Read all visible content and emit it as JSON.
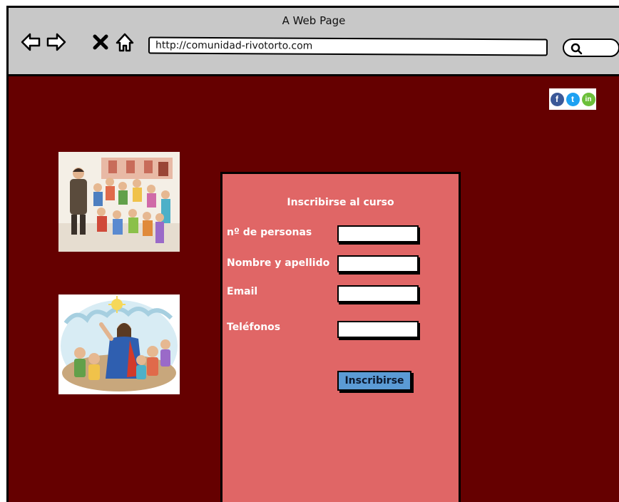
{
  "window": {
    "title": "A Web Page",
    "url": "http://comunidad-rivotorto.com"
  },
  "nav": {
    "icons": [
      "back-arrow-icon",
      "forward-arrow-icon",
      "close-icon",
      "home-icon"
    ]
  },
  "search": {
    "icon": "search-icon"
  },
  "social": {
    "icons": [
      "facebook-icon",
      "twitter-icon",
      "linkedin-icon"
    ],
    "glyphs": [
      "f",
      "t",
      "in"
    ],
    "colors": {
      "facebook": "#3b5998",
      "twitter": "#1da1f2",
      "linkedin": "#6cbf3a"
    }
  },
  "images": [
    {
      "name": "children-teacher-image"
    },
    {
      "name": "jesus-children-image"
    }
  ],
  "form": {
    "title": "Inscribirse al curso",
    "fields": [
      {
        "label": "nº de personas",
        "value": ""
      },
      {
        "label": "Nombre y apellido",
        "value": ""
      },
      {
        "label": "Email",
        "value": ""
      },
      {
        "label": "Teléfonos",
        "value": ""
      }
    ],
    "submit_label": "Inscribirse"
  },
  "colors": {
    "page_background": "#650000",
    "form_background": "#e06666",
    "browser_chrome": "#c8c8c8",
    "button": "#5b9bd5"
  }
}
